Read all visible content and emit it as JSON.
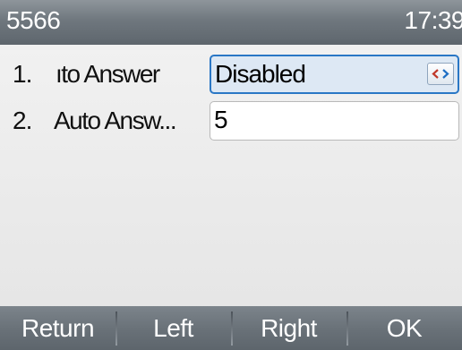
{
  "statusbar": {
    "extension": "5566",
    "time": "17:39"
  },
  "rows": [
    {
      "index": "1.",
      "label": "ıto Answer",
      "value": "Disabled",
      "has_switch": true
    },
    {
      "index": "2.",
      "label": "Auto Answ...",
      "value": "5",
      "has_switch": false
    }
  ],
  "switch_icon": "left-right-arrows-icon",
  "softkeys": {
    "return": "Return",
    "left": "Left",
    "right": "Right",
    "ok": "OK"
  },
  "colors": {
    "focus_border": "#2a77c5",
    "focus_fill": "#dde8f4",
    "switch_arrow": "#c0392b"
  }
}
